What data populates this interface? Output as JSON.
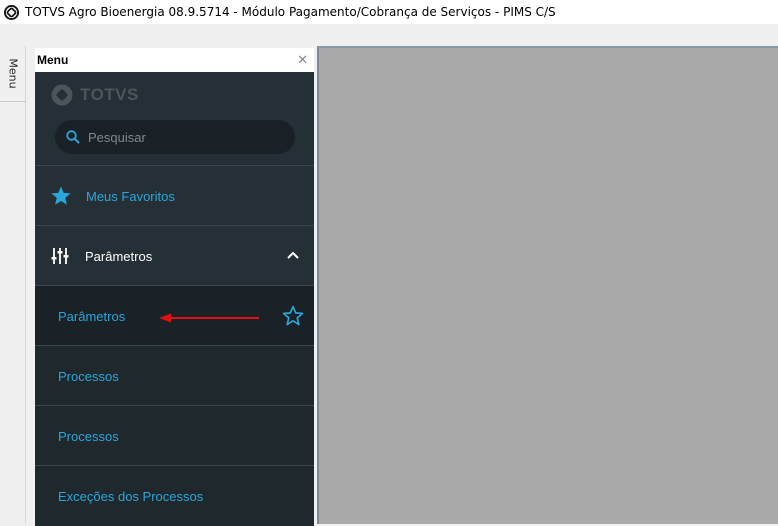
{
  "window": {
    "title": "TOTVS Agro Bioenergia 08.9.5714 - Módulo Pagamento/Cobrança de Serviços - PIMS C/S",
    "icon": "totvs-logo-icon"
  },
  "side_strip": {
    "tab_label": "Menu"
  },
  "menu": {
    "header_label": "Menu",
    "close_icon": "close-icon",
    "brand": "TOTVS",
    "search": {
      "placeholder": "Pesquisar",
      "value": ""
    },
    "favorites_label": "Meus Favoritos",
    "section": {
      "label": "Parâmetros",
      "expanded": true
    },
    "items": [
      {
        "label": "Parâmetros",
        "active": true
      },
      {
        "label": "Processos"
      },
      {
        "label": "Processos"
      },
      {
        "label": "Exceções dos Processos"
      }
    ]
  },
  "colors": {
    "menu_bg": "#253036",
    "accent": "#29a7d9",
    "content_bg": "#a9a9a9",
    "annotation_arrow": "#e01010"
  }
}
